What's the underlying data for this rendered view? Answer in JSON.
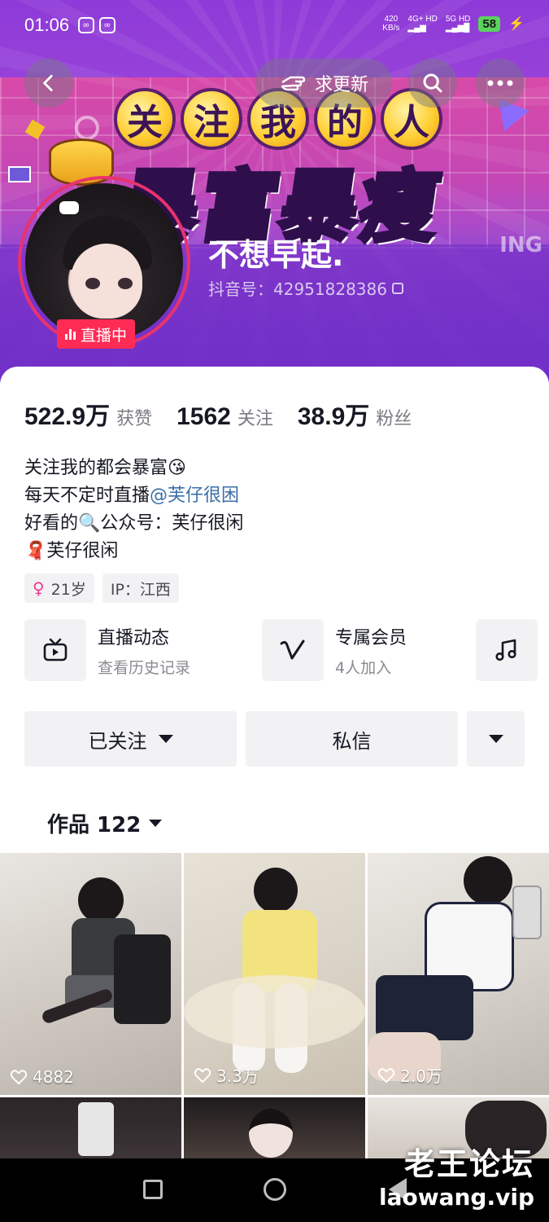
{
  "status_bar": {
    "time": "01:06",
    "speed_value": "420",
    "speed_unit": "KB/s",
    "network_1": "4G+ HD",
    "network_2": "5G HD",
    "battery": "58"
  },
  "nav": {
    "request_update_label": "求更新"
  },
  "banner": {
    "art_line1": [
      "关",
      "注",
      "我",
      "的",
      "人"
    ],
    "art_line2": "暴富暴瘦",
    "art_tag": "ING"
  },
  "profile": {
    "name": "不想早起.",
    "douyin_id": "抖音号：42951828386",
    "live_label": "直播中"
  },
  "stats": [
    {
      "value": "522.9万",
      "label": "获赞"
    },
    {
      "value": "1562",
      "label": "关注"
    },
    {
      "value": "38.9万",
      "label": "粉丝"
    }
  ],
  "bio": {
    "line1": "关注我的都会暴富😘",
    "line2_prefix": "每天不定时直播",
    "line2_mention": "@芙仔很困",
    "line3": "好看的🔍公众号：芙仔很闲",
    "line4": "🧣芙仔很闲"
  },
  "tags": {
    "age": "21岁",
    "ip": "IP：江西"
  },
  "features": [
    {
      "title": "直播动态",
      "subtitle": "查看历史记录",
      "icon": "tv-icon"
    },
    {
      "title": "专属会员",
      "subtitle": "4人加入",
      "icon": "v-icon"
    },
    {
      "icon": "music-note-icon"
    }
  ],
  "actions": {
    "follow_label": "已关注",
    "message_label": "私信"
  },
  "works": {
    "label": "作品 122"
  },
  "videos": [
    {
      "likes": "4882"
    },
    {
      "likes": "3.3万"
    },
    {
      "likes": "2.0万"
    }
  ],
  "watermark": {
    "line1": "老王论坛",
    "line2": "laowang.vip"
  },
  "colors": {
    "accent": "#fe2c55",
    "mention": "#3b6fa8",
    "banner_purple": "#8e3ad8"
  }
}
